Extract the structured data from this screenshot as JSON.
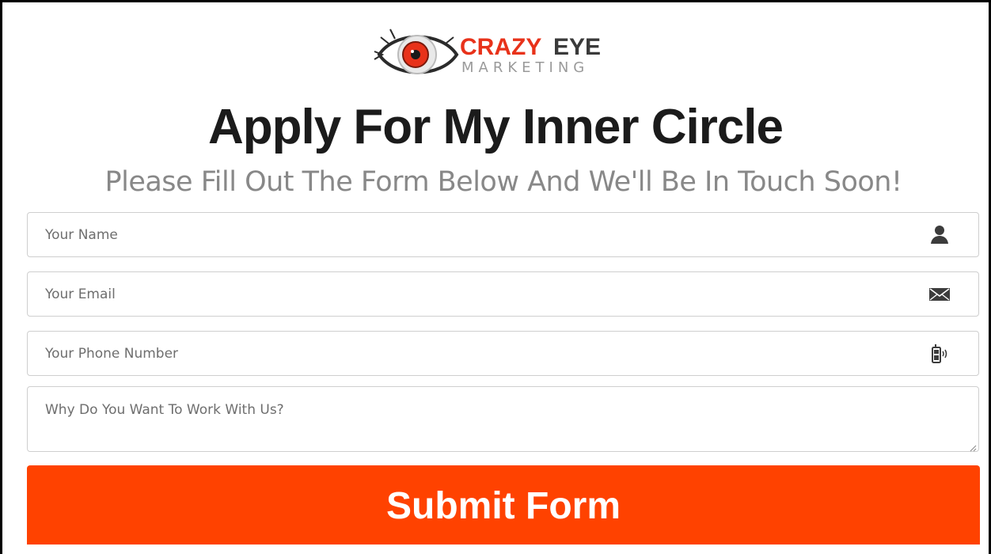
{
  "logo": {
    "brand_word_1": "CRAZY",
    "brand_word_2": "EYE",
    "brand_word_3": "MARKETING",
    "icon": "eye-logo-icon",
    "colors": {
      "red": "#e8321a",
      "dark": "#3a3a3a",
      "grey": "#9a9a9a"
    }
  },
  "headline": "Apply For My Inner Circle",
  "subheadline": "Please Fill Out The Form Below And We'll Be In Touch Soon!",
  "form": {
    "name_placeholder": "Your Name",
    "name_icon": "user-icon",
    "email_placeholder": "Your Email",
    "email_icon": "envelope-icon",
    "phone_placeholder": "Your Phone Number",
    "phone_icon": "mobile-phone-icon",
    "why_placeholder": "Why Do You Want To Work With Us?",
    "submit_label": "Submit Form"
  },
  "colors": {
    "accent": "#ff4200",
    "headline": "#1b1b1b",
    "subheadline": "#888888",
    "placeholder": "#6e6e6e",
    "field_border": "#cfcfcf"
  }
}
